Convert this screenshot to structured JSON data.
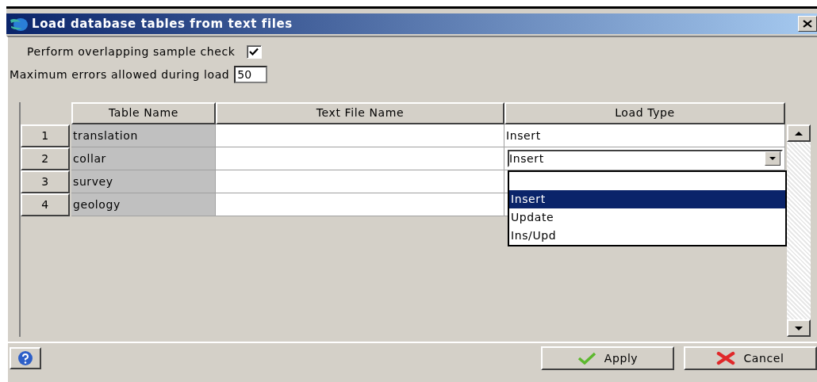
{
  "window": {
    "title": "Load database tables from text files"
  },
  "overlap_check": {
    "label": "Perform overlapping sample check",
    "checked": true
  },
  "max_errors": {
    "label": "Maximum errors allowed during load",
    "value": "50"
  },
  "table": {
    "columns": [
      "Table Name",
      "Text File Name",
      "Load Type"
    ],
    "rows": [
      {
        "number": "1",
        "table_name": "translation",
        "load_type": "Insert",
        "editing": false
      },
      {
        "number": "2",
        "table_name": "collar",
        "load_type": "Insert",
        "editing": true
      },
      {
        "number": "3",
        "table_name": "survey"
      },
      {
        "number": "4",
        "table_name": "geology"
      }
    ]
  },
  "dropdown": {
    "options": [
      {
        "label": "Insert",
        "selected": true
      },
      {
        "label": "Update",
        "selected": false
      },
      {
        "label": "Ins/Upd",
        "selected": false
      }
    ]
  },
  "buttons": [
    {
      "kind": "help"
    },
    {
      "kind": "apply",
      "label": "Apply"
    },
    {
      "kind": "cancel",
      "label": "Cancel"
    }
  ]
}
